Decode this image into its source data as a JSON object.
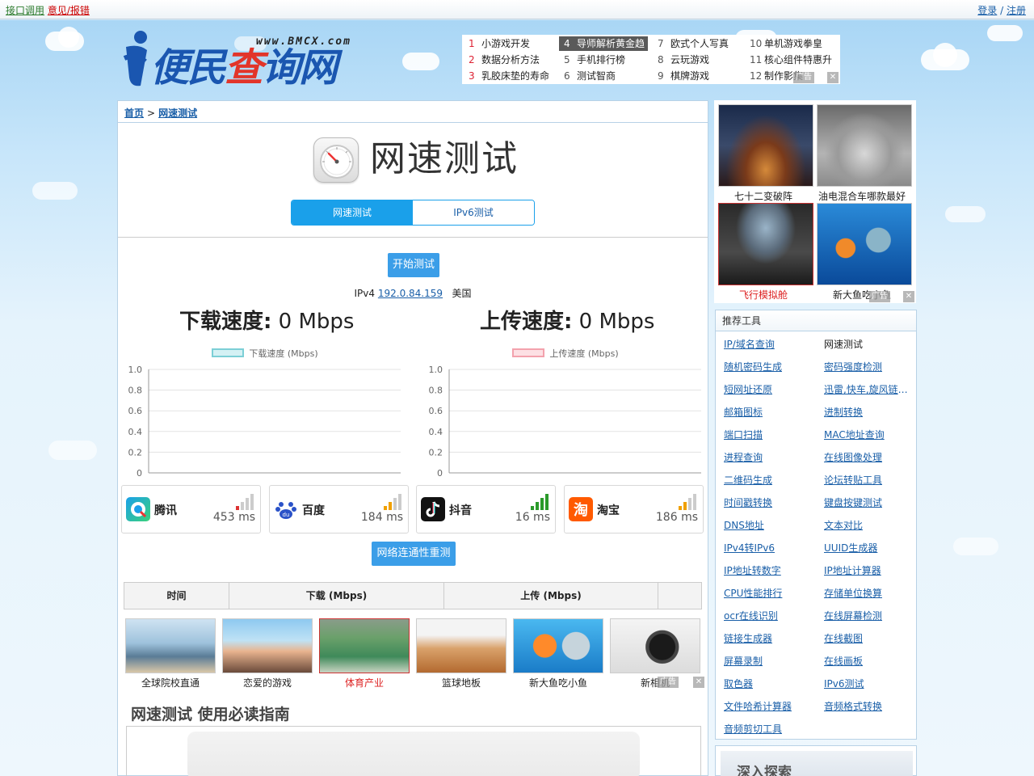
{
  "topbar": {
    "api_link": "接口调用",
    "feedback_link": "意见/报错",
    "login": "登录",
    "slash": " / ",
    "register": "注册"
  },
  "logo": {
    "domain": "www.BMCX.com",
    "name_part1": "便民",
    "name_part2": "查",
    "name_part3": "询网"
  },
  "hotlist": [
    {
      "n": "1",
      "t": "小游戏开发"
    },
    {
      "n": "2",
      "t": "数据分析方法"
    },
    {
      "n": "3",
      "t": "乳胶床垫的寿命"
    },
    {
      "n": "4",
      "t": "导师解析黄金趋"
    },
    {
      "n": "5",
      "t": "手机排行榜"
    },
    {
      "n": "6",
      "t": "测试智商"
    },
    {
      "n": "7",
      "t": "欧式个人写真"
    },
    {
      "n": "8",
      "t": "云玩游戏"
    },
    {
      "n": "9",
      "t": "棋牌游戏"
    },
    {
      "n": "10",
      "t": "单机游戏拳皇"
    },
    {
      "n": "11",
      "t": "核心组件特惠升"
    },
    {
      "n": "12",
      "t": "制作影集"
    }
  ],
  "ad_label": "广告",
  "ad_close": "✕",
  "breadcrumb": {
    "home": "首页",
    "sep": ">",
    "current": "网速测试"
  },
  "hero": {
    "title": "网速测试"
  },
  "tabs": {
    "speed": "网速测试",
    "ipv6": "IPv6测试"
  },
  "start_button": "开始测试",
  "ip": {
    "proto": "IPv4",
    "address": "192.0.84.159",
    "location": "美国"
  },
  "download": {
    "label": "下载速度:",
    "value": "0 Mbps"
  },
  "upload": {
    "label": "上传速度:",
    "value": "0 Mbps"
  },
  "chart_data": [
    {
      "type": "line",
      "series": [
        {
          "name": "下载速度 (Mbps)",
          "values": []
        }
      ],
      "ylim": [
        0,
        1.0
      ],
      "yticks": [
        "1.0",
        "0.8",
        "0.6",
        "0.4",
        "0.2",
        "0"
      ],
      "grid": true,
      "legend": "top",
      "color_fill": "#d4f1f4",
      "color_line": "#7ccfd6"
    },
    {
      "type": "line",
      "series": [
        {
          "name": "上传速度 (Mbps)",
          "values": []
        }
      ],
      "ylim": [
        0,
        1.0
      ],
      "yticks": [
        "1.0",
        "0.8",
        "0.6",
        "0.4",
        "0.2",
        "0"
      ],
      "grid": true,
      "legend": "top",
      "color_fill": "#fde0e4",
      "color_line": "#f3a2ad"
    }
  ],
  "ping": [
    {
      "name": "腾讯",
      "ms": "453 ms",
      "bars": 1,
      "bar_color": "#d33"
    },
    {
      "name": "百度",
      "ms": "184 ms",
      "bars": 2,
      "bar_color": "#f0a000"
    },
    {
      "name": "抖音",
      "ms": "16 ms",
      "bars": 4,
      "bar_color": "#2a9a2a"
    },
    {
      "name": "淘宝",
      "ms": "186 ms",
      "bars": 2,
      "bar_color": "#f0a000"
    }
  ],
  "retest_button": "网络连通性重测",
  "table": {
    "col_time": "时间",
    "col_down": "下载 (Mbps)",
    "col_up": "上传 (Mbps)"
  },
  "ads_bottom": [
    "全球院校直通",
    "恋爱的游戏",
    "体育产业",
    "篮球地板",
    "新大鱼吃小鱼",
    "新相机"
  ],
  "guide_title": "网速测试 使用必读指南",
  "ads_right": [
    "七十二变破阵",
    "油电混合车哪款最好",
    "飞行模拟舱",
    "新大鱼吃小鱼"
  ],
  "tools": {
    "header": "推荐工具",
    "items": [
      {
        "t": "IP/域名查询",
        "link": true
      },
      {
        "t": "网速测试",
        "link": false
      },
      {
        "t": "随机密码生成",
        "link": true
      },
      {
        "t": "密码强度检测",
        "link": true
      },
      {
        "t": "短网址还原",
        "link": true
      },
      {
        "t": "迅雷,快车,旋风链接转换",
        "link": true
      },
      {
        "t": "邮箱图标",
        "link": true
      },
      {
        "t": "进制转换",
        "link": true
      },
      {
        "t": "端口扫描",
        "link": true
      },
      {
        "t": "MAC地址查询",
        "link": true
      },
      {
        "t": "进程查询",
        "link": true
      },
      {
        "t": "在线图像处理",
        "link": true
      },
      {
        "t": "二维码生成",
        "link": true
      },
      {
        "t": "论坛转贴工具",
        "link": true
      },
      {
        "t": "时间戳转换",
        "link": true
      },
      {
        "t": "键盘按键测试",
        "link": true
      },
      {
        "t": "DNS地址",
        "link": true
      },
      {
        "t": "文本对比",
        "link": true
      },
      {
        "t": "IPv4转IPv6",
        "link": true
      },
      {
        "t": "UUID生成器",
        "link": true
      },
      {
        "t": "IP地址转数字",
        "link": true
      },
      {
        "t": "IP地址计算器",
        "link": true
      },
      {
        "t": "CPU性能排行",
        "link": true
      },
      {
        "t": "存储单位换算",
        "link": true
      },
      {
        "t": "ocr在线识别",
        "link": true
      },
      {
        "t": "在线屏幕检测",
        "link": true
      },
      {
        "t": "链接生成器",
        "link": true
      },
      {
        "t": "在线截图",
        "link": true
      },
      {
        "t": "屏幕录制",
        "link": true
      },
      {
        "t": "在线画板",
        "link": true
      },
      {
        "t": "取色器",
        "link": true
      },
      {
        "t": "IPv6测试",
        "link": true
      },
      {
        "t": "文件哈希计算器",
        "link": true
      },
      {
        "t": "音频格式转换",
        "link": true
      },
      {
        "t": "音频剪切工具",
        "link": true
      }
    ]
  },
  "explore": "深入探索"
}
